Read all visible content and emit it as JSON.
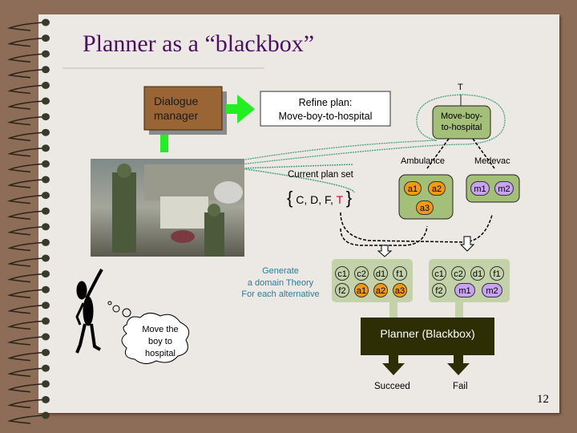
{
  "slide": {
    "title": "Planner as a “blackbox”",
    "page_number": "12"
  },
  "dialogue_manager": {
    "line1": "Dialogue",
    "line2": "manager"
  },
  "refine_plan": {
    "line1": "Refine plan:",
    "line2": "Move-boy-to-hospital"
  },
  "goal_node": {
    "top_label": "T",
    "line1": "Move-boy-",
    "line2": "to-hospital"
  },
  "alternatives": {
    "ambulance": {
      "label": "Ambulance",
      "actions": [
        "a1",
        "a2",
        "a3"
      ]
    },
    "medevac": {
      "label": "Medevac",
      "actions": [
        "m1",
        "m2"
      ]
    }
  },
  "plan_set": {
    "label": "Current plan set",
    "items": "C, D, F,",
    "highlight": "T"
  },
  "generate_text": {
    "line1": "Generate",
    "line2": "a domain Theory",
    "line3": "For each alternative"
  },
  "domain_theory_left": {
    "row1": [
      "c1",
      "c2",
      "d1",
      "f1"
    ],
    "row2": [
      "f2",
      "a1",
      "a2",
      "a3"
    ]
  },
  "domain_theory_right": {
    "row1": [
      "c1",
      "c2",
      "d1",
      "f1"
    ],
    "row2": [
      "f2",
      "m1",
      "m2"
    ]
  },
  "planner": {
    "label": "Planner (Blackbox)",
    "succeed": "Succeed",
    "fail": "Fail"
  },
  "thought": {
    "line1": "Move the",
    "line2": "boy to",
    "line3": "hospital"
  },
  "colors": {
    "title": "#4b1060",
    "dialogue_box": "#9a6535",
    "green_node": "#a3bf78",
    "ambulance_action": "#f39a10",
    "medevac_action": "#c9a3f2",
    "planner_box": "#2e2e05",
    "generate_text": "#2f7a9a",
    "highlight_T": "#c0102a",
    "arrow_green": "#22ee22"
  }
}
